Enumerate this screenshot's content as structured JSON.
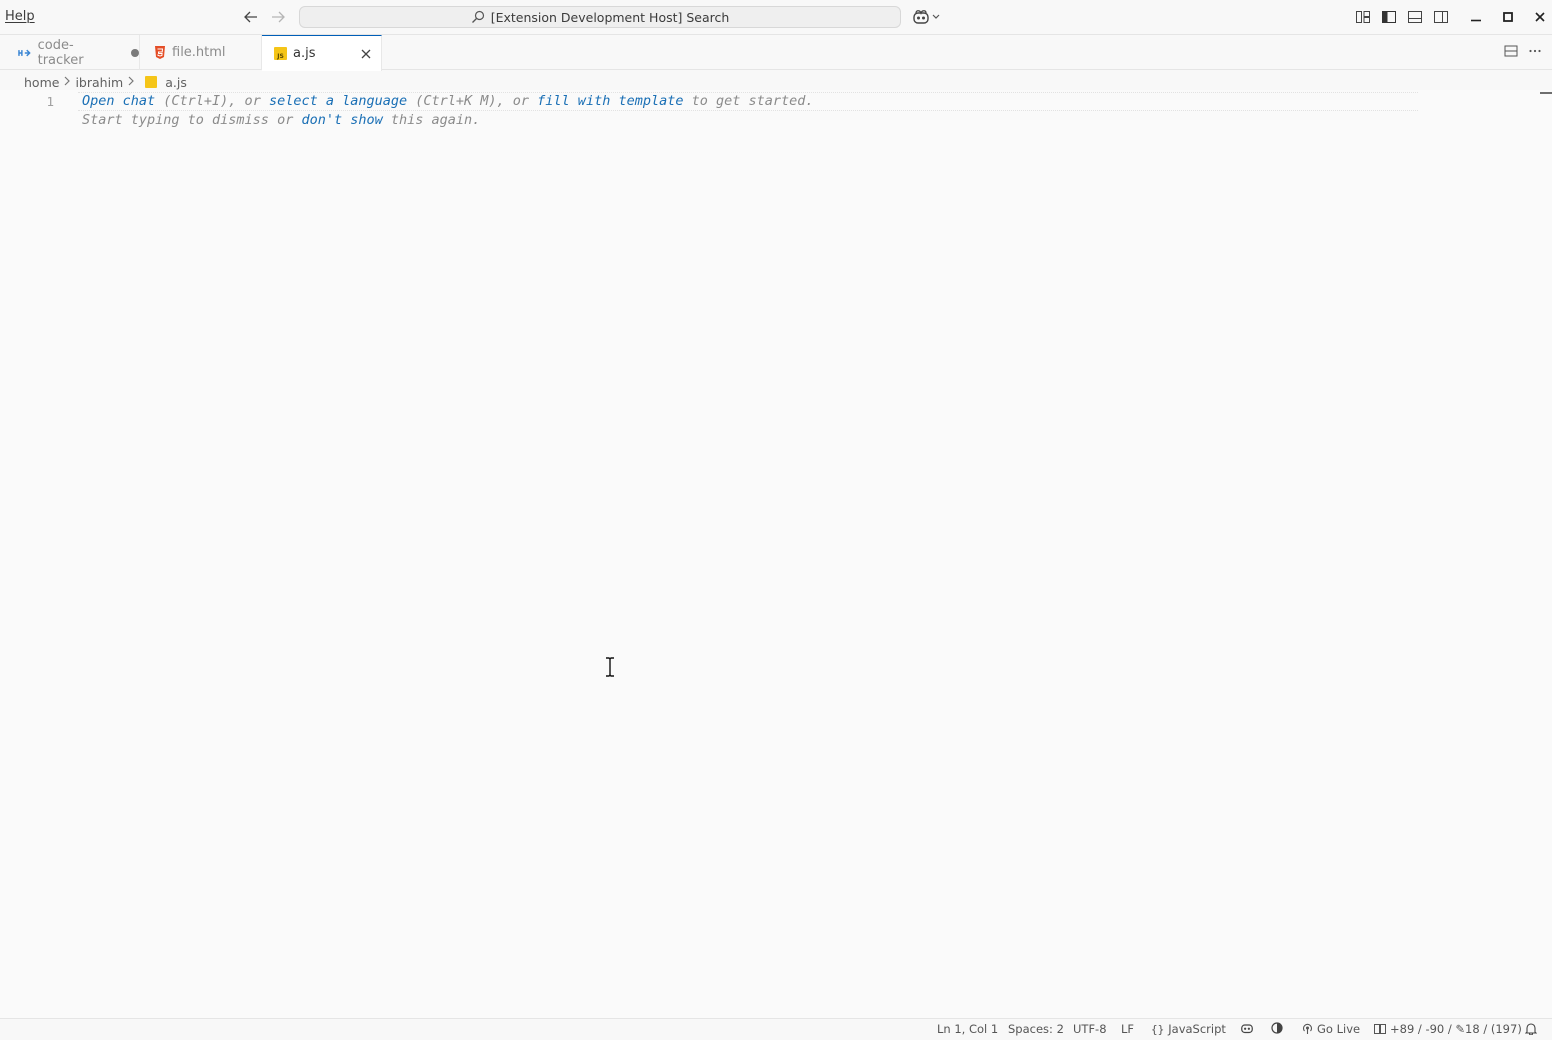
{
  "titlebar": {
    "menu_help": "Help",
    "search_text": "[Extension Development Host] Search"
  },
  "tabs": [
    {
      "label": "code-tracker",
      "icon": "extension-dev-icon",
      "modified": true
    },
    {
      "label": "file.html",
      "icon": "html5-icon"
    },
    {
      "label": "a.js",
      "icon": "js-file-icon",
      "active": true
    }
  ],
  "breadcrumb": [
    "home",
    "ibrahim",
    "a.js"
  ],
  "editor": {
    "line_number": "1",
    "hint_line1": {
      "open_chat": "Open chat",
      "t1": " (Ctrl+I), or ",
      "select_language": "select a language",
      "t2": " (Ctrl+K M), or ",
      "fill_template": "fill with template",
      "t3": " to get started."
    },
    "hint_line2": {
      "t1": "Start typing to dismiss or ",
      "dont_show": "don't show",
      "t2": " this again."
    }
  },
  "statusbar": {
    "position": "Ln 1, Col 1",
    "spaces": "Spaces: 2",
    "encoding": "UTF-8",
    "eol": "LF",
    "language": "JavaScript",
    "go_live": "Go Live",
    "diff_stats": "+89 / -90 / ✎18 / (197)"
  },
  "colors": {
    "accent": "#005fb8",
    "link": "#1a6fb5",
    "background": "#f8f8f8"
  }
}
